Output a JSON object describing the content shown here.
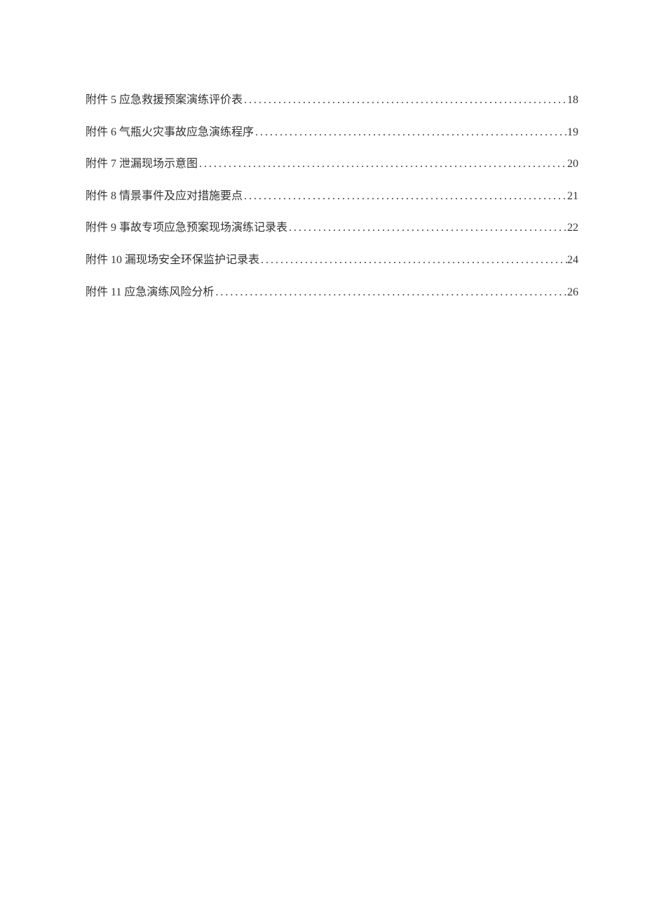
{
  "toc": [
    {
      "title": "附件 5 应急救援预案演练评价表",
      "page": "18"
    },
    {
      "title": "附件 6 气瓶火灾事故应急演练程序",
      "page": "19"
    },
    {
      "title": "附件 7 泄漏现场示意图",
      "page": "20"
    },
    {
      "title": "附件 8 情景事件及应对措施要点",
      "page": "21"
    },
    {
      "title": "附件 9 事故专项应急预案现场演练记录表",
      "page": "22"
    },
    {
      "title": "附件 10 漏现场安全环保监护记录表",
      "page": "24"
    },
    {
      "title": "附件 11 应急演练风险分析",
      "page": "26"
    }
  ]
}
